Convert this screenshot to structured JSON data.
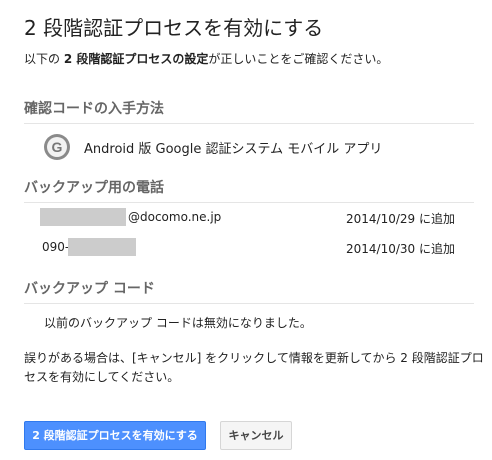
{
  "dialog": {
    "title": "2 段階認証プロセスを有効にする",
    "intro_before": "以下の ",
    "intro_bold": "2 段階認証プロセスの設定",
    "intro_after": "が正しいことをご確認ください。"
  },
  "sections": {
    "method": {
      "heading": "確認コードの入手方法",
      "icon": "google-g-icon",
      "icon_glyph": "G",
      "text": "Android 版 Google 認証システム モバイル アプリ"
    },
    "phones": {
      "heading": "バックアップ用の電話",
      "rows": [
        {
          "value": "@docomo.ne.jp",
          "date": "2014/10/29 に追加"
        },
        {
          "value": "090-",
          "date": "2014/10/30 に追加"
        }
      ]
    },
    "backup": {
      "heading": "バックアップ コード",
      "text": "以前のバックアップ コードは無効になりました。"
    }
  },
  "error_note": "誤りがある場合は、[キャンセル] をクリックして情報を更新してから 2 段階認証プロセスを有効にしてください。",
  "buttons": {
    "enable": "2 段階認証プロセスを有効にする",
    "cancel": "キャンセル"
  },
  "colors": {
    "primary": "#4d90fe",
    "heading": "#666666",
    "redaction": "#cccccc"
  }
}
